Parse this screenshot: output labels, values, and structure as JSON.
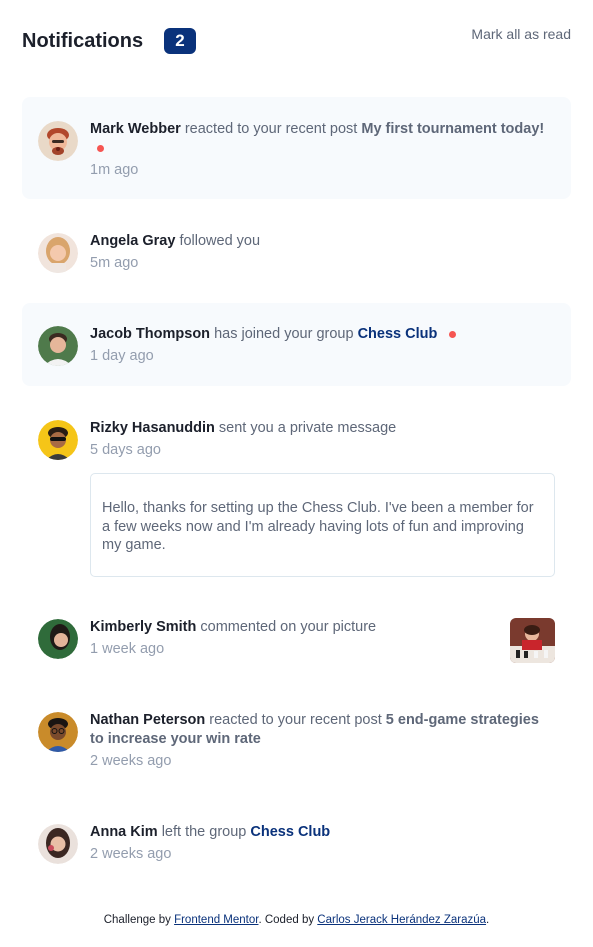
{
  "header": {
    "title": "Notifications",
    "unread_count": "2",
    "mark_all_label": "Mark all as read"
  },
  "notifications": [
    {
      "name": "Mark Webber",
      "action": "reacted to your recent post",
      "target": "My first tournament today!",
      "time": "1m ago",
      "unread": true
    },
    {
      "name": "Angela Gray",
      "action": "followed you",
      "time": "5m ago",
      "unread": false
    },
    {
      "name": "Jacob Thompson",
      "action": "has joined your group",
      "target": "Chess Club",
      "time": "1 day ago",
      "unread": true
    },
    {
      "name": "Rizky Hasanuddin",
      "action": "sent you a private message",
      "time": "5 days ago",
      "unread": false,
      "message": "Hello, thanks for setting up the Chess Club. I've been a member for a few weeks now and I'm already having lots of fun and improving my game."
    },
    {
      "name": "Kimberly Smith",
      "action": "commented on your picture",
      "time": "1 week ago",
      "unread": false
    },
    {
      "name": "Nathan Peterson",
      "action": "reacted to your recent post",
      "target": "5 end-game strategies to increase your win rate",
      "time": "2 weeks ago",
      "unread": false
    },
    {
      "name": "Anna Kim",
      "action": "left the group",
      "target": "Chess Club",
      "time": "2 weeks ago",
      "unread": false
    }
  ],
  "footer": {
    "prefix": "Challenge by",
    "link1": "Frontend Mentor",
    "middle": ". Coded by",
    "link2": "Carlos Jerack Heránd­ez Zarazúa",
    "suffix": "."
  },
  "colors": {
    "accent": "#0a327b",
    "unread_bg": "#f7fafd",
    "dot": "#f65552"
  }
}
